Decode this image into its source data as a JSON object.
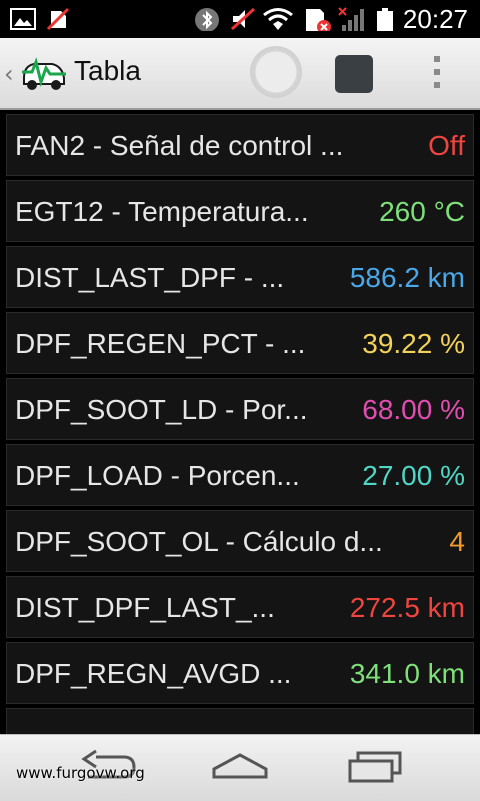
{
  "status_bar": {
    "time": "20:27",
    "icons": [
      "image-icon",
      "no-sim-icon",
      "bluetooth-icon",
      "mute-icon",
      "wifi-icon",
      "sd-card-icon",
      "signal-icon",
      "battery-icon"
    ]
  },
  "action_bar": {
    "up_caret": "‹",
    "title": "Tabla"
  },
  "table": {
    "rows": [
      {
        "label": "FAN2 - Señal de control ...",
        "value": "Off",
        "color": "#f0453f"
      },
      {
        "label": "EGT12 - Temperatura...",
        "value": "260 °C",
        "color": "#7fe07a"
      },
      {
        "label": "DIST_LAST_DPF - ...",
        "value": "586.2 km",
        "color": "#4aa8e8"
      },
      {
        "label": "DPF_REGEN_PCT - ...",
        "value": "39.22 %",
        "color": "#f2d25a"
      },
      {
        "label": "DPF_SOOT_LD - Por...",
        "value": "68.00 %",
        "color": "#e24db2"
      },
      {
        "label": "DPF_LOAD - Porcen...",
        "value": "27.00 %",
        "color": "#4fd6c4"
      },
      {
        "label": "DPF_SOOT_OL - Cálculo d...",
        "value": "4",
        "color": "#f29a2e"
      },
      {
        "label": "DIST_DPF_LAST_...",
        "value": "272.5 km",
        "color": "#f0453f"
      },
      {
        "label": "DPF_REGN_AVGD ...",
        "value": "341.0 km",
        "color": "#7fe07a"
      }
    ]
  },
  "nav_bar": {
    "watermark": "www.furgovw.org"
  }
}
